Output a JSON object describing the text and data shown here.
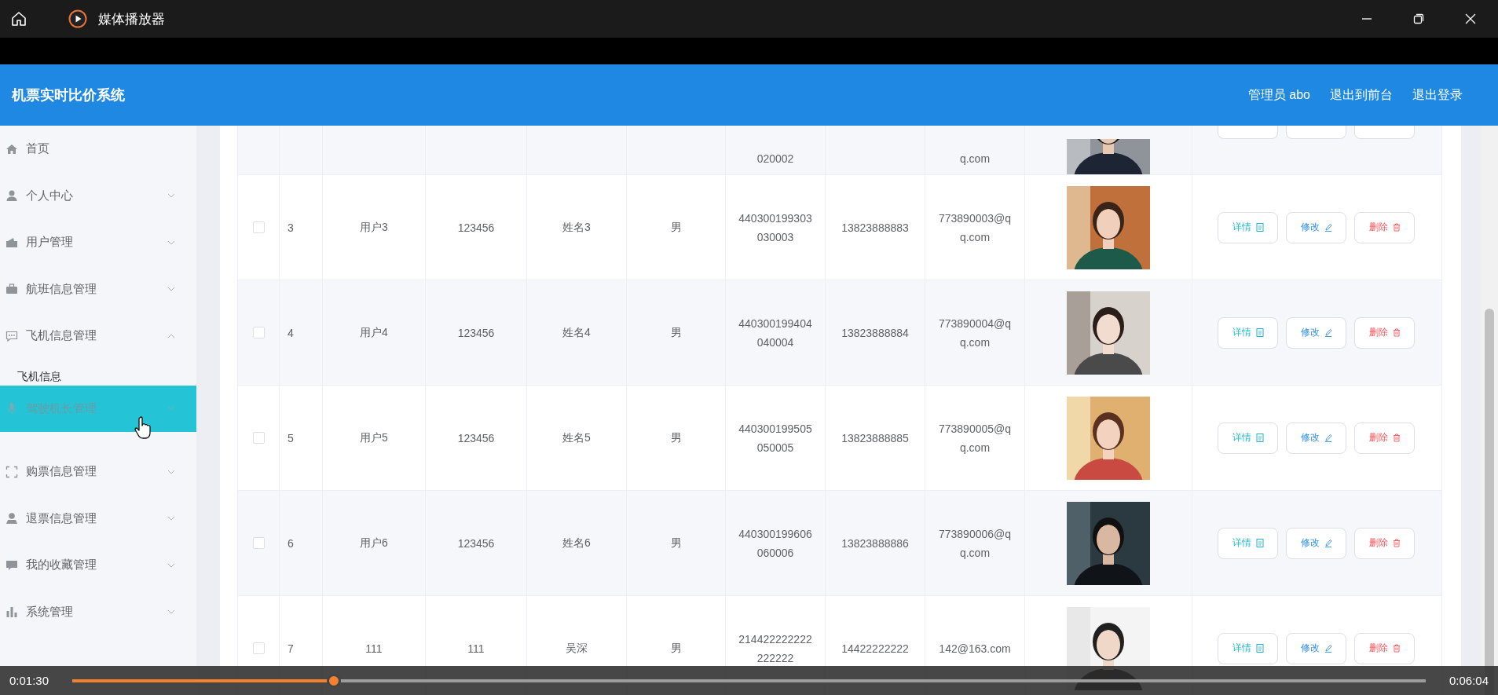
{
  "player": {
    "title": "媒体播放器",
    "current_time": "0:01:30",
    "total_time": "0:06:04",
    "progress": {
      "level": 0.193
    }
  },
  "header": {
    "title": "机票实时比价系统",
    "user": "管理员 abo",
    "links": [
      "退出到前台",
      "退出登录"
    ]
  },
  "sidebar": {
    "items": [
      {
        "label": "首页",
        "kind": "link",
        "hovered": false
      },
      {
        "label": "个人中心",
        "kind": "submenu",
        "expanded": false,
        "hovered": false
      },
      {
        "label": "用户管理",
        "kind": "submenu",
        "expanded": false,
        "hovered": false
      },
      {
        "label": "航班信息管理",
        "kind": "submenu",
        "expanded": false,
        "hovered": false
      },
      {
        "label": "飞机信息管理",
        "kind": "submenu",
        "expanded": true,
        "hovered": false,
        "children": [
          {
            "label": "飞机信息"
          }
        ]
      },
      {
        "label": "驾驶机长管理",
        "kind": "submenu",
        "expanded": false,
        "hovered": true
      },
      {
        "label": "购票信息管理",
        "kind": "submenu",
        "expanded": false,
        "hovered": false
      },
      {
        "label": "退票信息管理",
        "kind": "submenu",
        "expanded": false,
        "hovered": false
      },
      {
        "label": "我的收藏管理",
        "kind": "submenu",
        "expanded": false,
        "hovered": false
      },
      {
        "label": "系统管理",
        "kind": "submenu",
        "expanded": false,
        "hovered": false
      }
    ]
  },
  "table": {
    "partial_row": {
      "id_number": "020002",
      "email": "q.com"
    },
    "rows": [
      {
        "checked": false,
        "index": "3",
        "username": "用户3",
        "password": "123456",
        "name": "姓名3",
        "gender": "男",
        "id_number": "440300199303030003",
        "phone": "13823888883",
        "email": "773890003@qq.com",
        "actions": [
          {
            "label": "详情",
            "kind": "detail"
          },
          {
            "label": "修改",
            "kind": "edit"
          },
          {
            "label": "删除",
            "kind": "delete"
          }
        ]
      },
      {
        "checked": false,
        "index": "4",
        "username": "用户4",
        "password": "123456",
        "name": "姓名4",
        "gender": "男",
        "id_number": "440300199404040004",
        "phone": "13823888884",
        "email": "773890004@qq.com",
        "actions": [
          {
            "label": "详情",
            "kind": "detail"
          },
          {
            "label": "修改",
            "kind": "edit"
          },
          {
            "label": "删除",
            "kind": "delete"
          }
        ]
      },
      {
        "checked": false,
        "index": "5",
        "username": "用户5",
        "password": "123456",
        "name": "姓名5",
        "gender": "男",
        "id_number": "440300199505050005",
        "phone": "13823888885",
        "email": "773890005@qq.com",
        "actions": [
          {
            "label": "详情",
            "kind": "detail"
          },
          {
            "label": "修改",
            "kind": "edit"
          },
          {
            "label": "删除",
            "kind": "delete"
          }
        ]
      },
      {
        "checked": false,
        "index": "6",
        "username": "用户6",
        "password": "123456",
        "name": "姓名6",
        "gender": "男",
        "id_number": "440300199606060006",
        "phone": "13823888886",
        "email": "773890006@qq.com",
        "actions": [
          {
            "label": "详情",
            "kind": "detail"
          },
          {
            "label": "修改",
            "kind": "edit"
          },
          {
            "label": "删除",
            "kind": "delete"
          }
        ]
      },
      {
        "checked": false,
        "index": "7",
        "username": "111",
        "password": "111",
        "name": "吴深",
        "gender": "男",
        "id_number": "214422222222222222",
        "phone": "14422222222",
        "email": "142@163.com",
        "actions": [
          {
            "label": "详情",
            "kind": "detail"
          },
          {
            "label": "修改",
            "kind": "edit"
          },
          {
            "label": "删除",
            "kind": "delete"
          }
        ]
      }
    ]
  }
}
